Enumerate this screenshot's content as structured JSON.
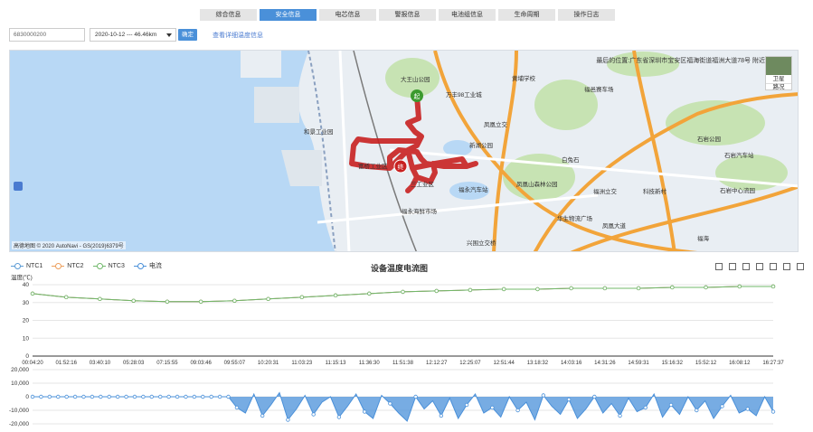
{
  "tabs": [
    {
      "label": "综合信息",
      "active": false
    },
    {
      "label": "安全信息",
      "active": true
    },
    {
      "label": "电芯信息",
      "active": false
    },
    {
      "label": "警报信息",
      "active": false
    },
    {
      "label": "电池组信息",
      "active": false
    },
    {
      "label": "生命周期",
      "active": false
    },
    {
      "label": "操作日志",
      "active": false
    }
  ],
  "toolbar": {
    "device_id": "6830000200",
    "date_range": "2020-10-12 --- 46.46km",
    "confirm_label": "确定",
    "detail_link": "查看详细温度信息"
  },
  "map": {
    "address": "最后的位置:广东省深圳市宝安区福海街道福洲大道78号 附近",
    "satellite_label": "卫星",
    "roadnet_label": "路况",
    "copyright": "高德地图 © 2020 AutoNavi - GS(2019)6379号",
    "start_marker": "起",
    "end_marker": "终",
    "places": [
      "大王山公园",
      "万丰98工业城",
      "黄埔学校",
      "福邑赛车场",
      "凤凰立交",
      "新湖公园",
      "富桥工业区",
      "三工业区",
      "福永汽车站",
      "福永海鲜市场",
      "凤凰山森林公园",
      "白兔石",
      "福洲立交",
      "科技新村",
      "华生物流广场",
      "兴围立交桥",
      "和景工业园",
      "石岩公园",
      "石岩汽车站",
      "石岩中心流园",
      "福海",
      "凤凰大道"
    ],
    "colors": {
      "track": "#c82020",
      "highway": "#f2a43a",
      "water": "#b8d8f5",
      "park": "#c7e3b3"
    }
  },
  "chart": {
    "title": "设备温度电流图",
    "unit_label": "温度(℃)",
    "legend": [
      {
        "name": "NTC1",
        "color": "#5b9bd5"
      },
      {
        "name": "NTC2",
        "color": "#ed9e5b"
      },
      {
        "name": "NTC3",
        "color": "#70b86a"
      },
      {
        "name": "电流",
        "color": "#4a90d9"
      }
    ],
    "tools": [
      "zoom-icon",
      "zoom-reset-icon",
      "data-view-icon",
      "line-icon",
      "bar-icon",
      "restore-icon",
      "download-icon"
    ]
  },
  "chart_data": [
    {
      "type": "line",
      "title": "设备温度电流图",
      "ylabel": "温度(℃)",
      "ylim": [
        0,
        40
      ],
      "yticks": [
        "0",
        "10",
        "20",
        "30",
        "40"
      ],
      "categories": [
        "00:04:20",
        "01:52:16",
        "03:40:10",
        "05:28:03",
        "07:15:55",
        "09:03:46",
        "09:55:07",
        "10:20:31",
        "11:03:23",
        "11:15:13",
        "11:36:30",
        "11:51:38",
        "12:12:27",
        "12:25:07",
        "12:51:44",
        "13:18:32",
        "14:03:16",
        "14:31:26",
        "14:59:31",
        "15:16:32",
        "15:52:12",
        "16:08:12",
        "16:27:37"
      ],
      "series": [
        {
          "name": "NTC1",
          "values": [
            35,
            33,
            32,
            31,
            30.5,
            30.5,
            31,
            32,
            33,
            34,
            35,
            36,
            36.5,
            37,
            37.5,
            37.5,
            38,
            38,
            38,
            38.5,
            38.5,
            39,
            39
          ]
        },
        {
          "name": "NTC2",
          "values": [
            35,
            33,
            32,
            31,
            30.5,
            30.5,
            31,
            32,
            33,
            34,
            35,
            36,
            36.5,
            37,
            37.5,
            37.5,
            38,
            38,
            38,
            38.5,
            38.5,
            39,
            39
          ]
        },
        {
          "name": "NTC3",
          "values": [
            35,
            33,
            32,
            31,
            30.5,
            30.5,
            31,
            32,
            33,
            34,
            35,
            36,
            36.5,
            37,
            37.5,
            37.5,
            38,
            38,
            38,
            38.5,
            38.5,
            39,
            39
          ]
        }
      ],
      "grid": true,
      "legend_placement": "top-left"
    },
    {
      "type": "area",
      "yticks": [
        "20,000",
        "10,000",
        "0",
        "-10,000",
        "-20,000"
      ],
      "ylim": [
        -20000,
        20000
      ],
      "series": [
        {
          "name": "电流",
          "values": [
            0,
            0,
            0,
            0,
            0,
            0,
            0,
            0,
            0,
            0,
            0,
            0,
            0,
            0,
            0,
            0,
            0,
            0,
            0,
            0,
            0,
            0,
            0,
            0,
            -8000,
            -12000,
            2000,
            -14000,
            -6000,
            3000,
            -17000,
            -9000,
            1000,
            -13000,
            -4000,
            0,
            -15000,
            -7000,
            2000,
            -11000,
            -16000,
            1000,
            -5000,
            -12000,
            -18000,
            0,
            -9000,
            -3000,
            -14000,
            -1000,
            -16000,
            -6000,
            2000,
            -12000,
            -8000,
            -15000,
            0,
            -10000,
            -4000,
            -17000,
            1000,
            -7000,
            -13000,
            -2000,
            -16000,
            -9000,
            0,
            -12000,
            -5000,
            -14000,
            -1000,
            -11000,
            -8000,
            2000,
            -15000,
            -6000,
            -13000,
            0,
            -10000,
            -3000,
            -16000,
            -7000,
            1000,
            -12000,
            -9000,
            -14000,
            0,
            -11000
          ]
        }
      ],
      "grid": true
    }
  ]
}
